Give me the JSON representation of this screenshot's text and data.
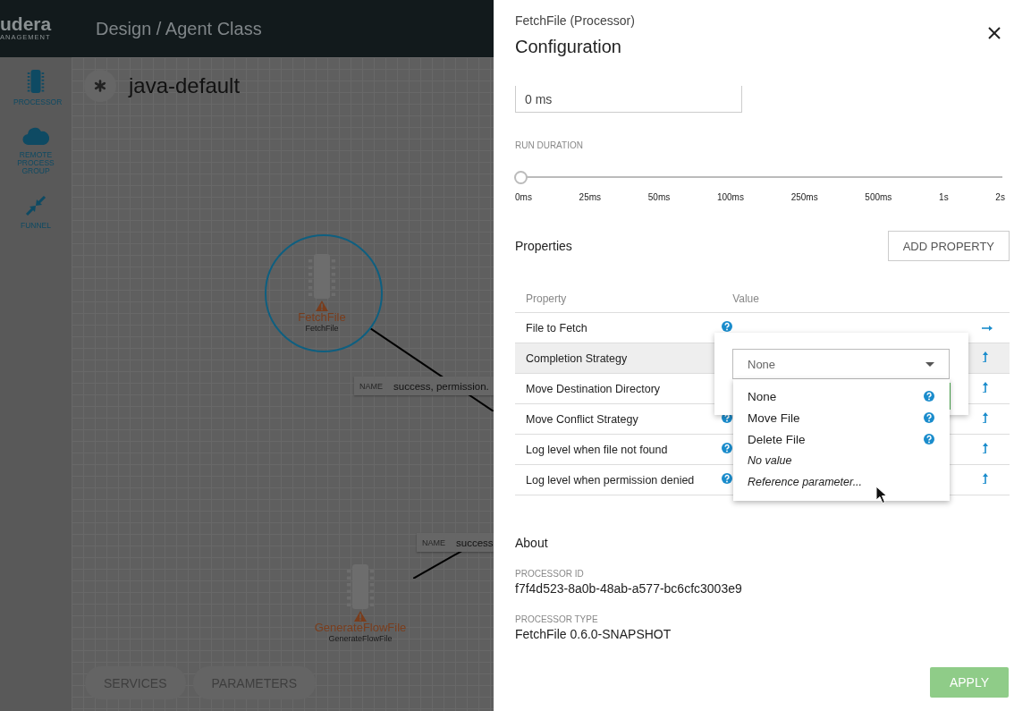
{
  "header": {
    "logo": "udera",
    "logo_sub": "ANAGEMENT",
    "title": "Design / Agent Class"
  },
  "sidebar": {
    "items": [
      {
        "label": "PROCESSOR",
        "kind": "processor"
      },
      {
        "label": "REMOTE PROCESS GROUP",
        "kind": "cloud"
      },
      {
        "label": "FUNNEL",
        "kind": "funnel"
      }
    ]
  },
  "canvas": {
    "title": "java-default",
    "nodes": [
      {
        "name": "FetchFile",
        "type": "FetchFile",
        "selected": true,
        "warning": true
      },
      {
        "name": "GenerateFlowFile",
        "type": "GenerateFlowFile",
        "selected": false,
        "warning": true
      }
    ],
    "connections": [
      {
        "key": "NAME",
        "name": "success, permission."
      },
      {
        "key": "NAME",
        "name": "success"
      }
    ],
    "buttons": [
      "SERVICES",
      "PARAMETERS"
    ]
  },
  "panel": {
    "subtitle": "FetchFile (Processor)",
    "title": "Configuration",
    "field_value": "0 ms",
    "run_duration": {
      "label": "RUN DURATION",
      "level": 0,
      "ticks": [
        "0ms",
        "25ms",
        "50ms",
        "100ms",
        "250ms",
        "500ms",
        "1s",
        "2s"
      ]
    },
    "properties_title": "Properties",
    "add_button": "ADD PROPERTY",
    "columns": [
      "Property",
      "Value"
    ],
    "rows": [
      {
        "name": "File to Fetch",
        "help": true,
        "selected": false,
        "kind": "rightarrow"
      },
      {
        "name": "Completion Strategy",
        "help": false,
        "selected": true,
        "kind": "uparrow"
      },
      {
        "name": "Move Destination Directory",
        "help": false,
        "selected": false,
        "kind": "uparrow"
      },
      {
        "name": "Move Conflict Strategy",
        "help": true,
        "selected": false,
        "kind": "uparrow"
      },
      {
        "name": "Log level when file not found",
        "help": true,
        "selected": false,
        "kind": "uparrow"
      },
      {
        "name": "Log level when permission denied",
        "help": true,
        "selected": false,
        "kind": "uparrow"
      }
    ],
    "editor": {
      "value": "None",
      "options": [
        {
          "label": "None",
          "help": true,
          "italic": false
        },
        {
          "label": "Move File",
          "help": true,
          "italic": false
        },
        {
          "label": "Delete File",
          "help": true,
          "italic": false
        },
        {
          "label": "No value",
          "help": false,
          "italic": true
        },
        {
          "label": "Reference parameter...",
          "help": false,
          "italic": true
        }
      ]
    },
    "about": {
      "title": "About",
      "fields": [
        {
          "label": "PROCESSOR ID",
          "value": "f7f4d523-8a0b-48ab-a577-bc6cfc3003e9"
        },
        {
          "label": "PROCESSOR TYPE",
          "value": "FetchFile 0.6.0-SNAPSHOT"
        }
      ]
    },
    "apply_button": "APPLY"
  }
}
